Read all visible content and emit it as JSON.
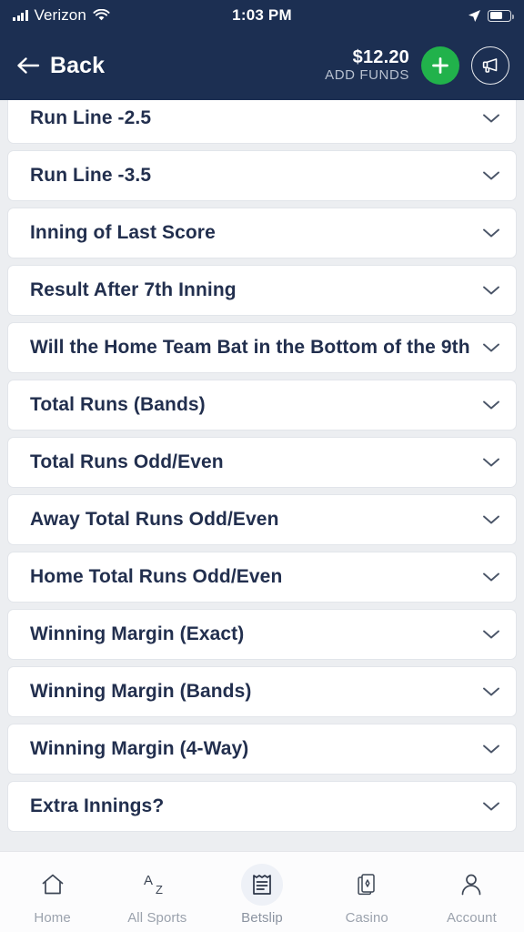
{
  "status_bar": {
    "carrier": "Verizon",
    "time": "1:03 PM",
    "signal_icon": "signal-bars-icon",
    "wifi_icon": "wifi-icon",
    "location_icon": "location-arrow-icon",
    "battery_icon": "battery-icon",
    "battery_level": 62
  },
  "header": {
    "back_label": "Back",
    "back_icon": "arrow-left-icon",
    "balance": "$12.20",
    "add_funds_label": "ADD FUNDS",
    "add_icon": "plus-icon",
    "promo_icon": "megaphone-icon",
    "bg_color": "#1c2f52",
    "accent_green": "#21b24b"
  },
  "markets": [
    {
      "title": "Run Line -2.5",
      "expand_icon": "chevron-down-icon"
    },
    {
      "title": "Run Line -3.5",
      "expand_icon": "chevron-down-icon"
    },
    {
      "title": "Inning of Last Score",
      "expand_icon": "chevron-down-icon"
    },
    {
      "title": "Result After 7th Inning",
      "expand_icon": "chevron-down-icon"
    },
    {
      "title": "Will the Home Team Bat in the Bottom of the 9th",
      "expand_icon": "chevron-down-icon"
    },
    {
      "title": "Total Runs (Bands)",
      "expand_icon": "chevron-down-icon"
    },
    {
      "title": "Total Runs Odd/Even",
      "expand_icon": "chevron-down-icon"
    },
    {
      "title": "Away Total Runs Odd/Even",
      "expand_icon": "chevron-down-icon"
    },
    {
      "title": "Home Total Runs Odd/Even",
      "expand_icon": "chevron-down-icon"
    },
    {
      "title": "Winning Margin (Exact)",
      "expand_icon": "chevron-down-icon"
    },
    {
      "title": "Winning Margin (Bands)",
      "expand_icon": "chevron-down-icon"
    },
    {
      "title": "Winning Margin (4-Way)",
      "expand_icon": "chevron-down-icon"
    },
    {
      "title": "Extra Innings?",
      "expand_icon": "chevron-down-icon"
    }
  ],
  "tabs": [
    {
      "label": "Home",
      "icon": "home-icon",
      "active": false
    },
    {
      "label": "All Sports",
      "icon": "a-to-z-icon",
      "active": false
    },
    {
      "label": "Betslip",
      "icon": "betslip-icon",
      "active": true
    },
    {
      "label": "Casino",
      "icon": "playing-cards-icon",
      "active": false
    },
    {
      "label": "Account",
      "icon": "person-icon",
      "active": false
    }
  ]
}
